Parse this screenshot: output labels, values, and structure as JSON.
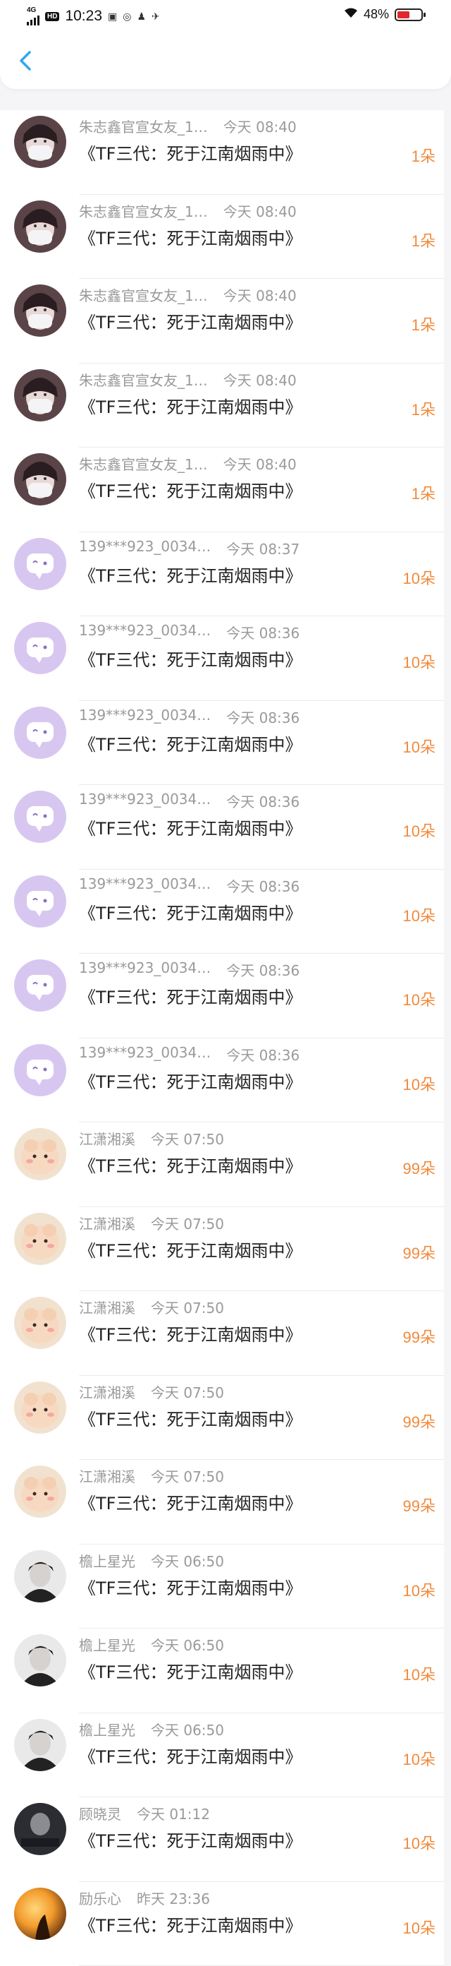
{
  "status_bar": {
    "network": "4G",
    "hd": "HD",
    "time": "10:23",
    "battery": "48%",
    "battery_level": 0.48,
    "battery_color": "#e0282e"
  },
  "nav": {
    "back_icon": "chevron-left-icon",
    "accent": "#2fa8f0"
  },
  "gift_color": "#f08a3c",
  "rows": [
    {
      "user": "朱志鑫官宣女友_1…",
      "time": "今天 08:40",
      "msg": "《TF三代：死于江南烟雨中》",
      "count": "1朵",
      "avatar": "mask"
    },
    {
      "user": "朱志鑫官宣女友_1…",
      "time": "今天 08:40",
      "msg": "《TF三代：死于江南烟雨中》",
      "count": "1朵",
      "avatar": "mask"
    },
    {
      "user": "朱志鑫官宣女友_1…",
      "time": "今天 08:40",
      "msg": "《TF三代：死于江南烟雨中》",
      "count": "1朵",
      "avatar": "mask"
    },
    {
      "user": "朱志鑫官宣女友_1…",
      "time": "今天 08:40",
      "msg": "《TF三代：死于江南烟雨中》",
      "count": "1朵",
      "avatar": "mask"
    },
    {
      "user": "朱志鑫官宣女友_1…",
      "time": "今天 08:40",
      "msg": "《TF三代：死于江南烟雨中》",
      "count": "1朵",
      "avatar": "mask"
    },
    {
      "user": "139***923_0034…",
      "time": "今天 08:37",
      "msg": "《TF三代：死于江南烟雨中》",
      "count": "10朵",
      "avatar": "bubble"
    },
    {
      "user": "139***923_0034…",
      "time": "今天 08:36",
      "msg": "《TF三代：死于江南烟雨中》",
      "count": "10朵",
      "avatar": "bubble"
    },
    {
      "user": "139***923_0034…",
      "time": "今天 08:36",
      "msg": "《TF三代：死于江南烟雨中》",
      "count": "10朵",
      "avatar": "bubble"
    },
    {
      "user": "139***923_0034…",
      "time": "今天 08:36",
      "msg": "《TF三代：死于江南烟雨中》",
      "count": "10朵",
      "avatar": "bubble"
    },
    {
      "user": "139***923_0034…",
      "time": "今天 08:36",
      "msg": "《TF三代：死于江南烟雨中》",
      "count": "10朵",
      "avatar": "bubble"
    },
    {
      "user": "139***923_0034…",
      "time": "今天 08:36",
      "msg": "《TF三代：死于江南烟雨中》",
      "count": "10朵",
      "avatar": "bubble"
    },
    {
      "user": "139***923_0034…",
      "time": "今天 08:36",
      "msg": "《TF三代：死于江南烟雨中》",
      "count": "10朵",
      "avatar": "bubble"
    },
    {
      "user": "江潇湘溪",
      "time": "今天 07:50",
      "msg": "《TF三代：死于江南烟雨中》",
      "count": "99朵",
      "avatar": "cartoon"
    },
    {
      "user": "江潇湘溪",
      "time": "今天 07:50",
      "msg": "《TF三代：死于江南烟雨中》",
      "count": "99朵",
      "avatar": "cartoon"
    },
    {
      "user": "江潇湘溪",
      "time": "今天 07:50",
      "msg": "《TF三代：死于江南烟雨中》",
      "count": "99朵",
      "avatar": "cartoon"
    },
    {
      "user": "江潇湘溪",
      "time": "今天 07:50",
      "msg": "《TF三代：死于江南烟雨中》",
      "count": "99朵",
      "avatar": "cartoon"
    },
    {
      "user": "江潇湘溪",
      "time": "今天 07:50",
      "msg": "《TF三代：死于江南烟雨中》",
      "count": "99朵",
      "avatar": "cartoon"
    },
    {
      "user": "檐上星光",
      "time": "今天 06:50",
      "msg": "《TF三代：死于江南烟雨中》",
      "count": "10朵",
      "avatar": "portrait"
    },
    {
      "user": "檐上星光",
      "time": "今天 06:50",
      "msg": "《TF三代：死于江南烟雨中》",
      "count": "10朵",
      "avatar": "portrait"
    },
    {
      "user": "檐上星光",
      "time": "今天 06:50",
      "msg": "《TF三代：死于江南烟雨中》",
      "count": "10朵",
      "avatar": "portrait"
    },
    {
      "user": "顾晓灵",
      "time": "今天 01:12",
      "msg": "《TF三代：死于江南烟雨中》",
      "count": "10朵",
      "avatar": "dark"
    },
    {
      "user": "励乐心",
      "time": "昨天 23:36",
      "msg": "《TF三代：死于江南烟雨中》",
      "count": "10朵",
      "avatar": "sunset"
    }
  ]
}
